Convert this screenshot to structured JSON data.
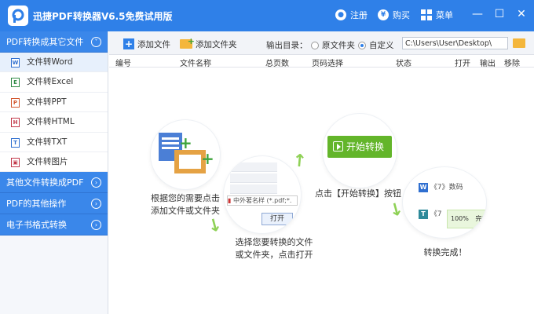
{
  "app": {
    "title": "迅捷PDF转换器V6.5免费试用版",
    "accent": "#2f80e8",
    "register": "注册",
    "buy": "购买",
    "menu": "菜单"
  },
  "sidebar": {
    "groups": [
      {
        "label": "PDF转换成其它文件",
        "expanded": true
      },
      {
        "label": "其他文件转换成PDF",
        "expanded": false
      },
      {
        "label": "PDF的其他操作",
        "expanded": false
      },
      {
        "label": "电子书格式转换",
        "expanded": false
      }
    ],
    "items": [
      {
        "label": "文件转Word",
        "icon": "W",
        "color": "#2f6fd0"
      },
      {
        "label": "文件转Excel",
        "icon": "E",
        "color": "#2e8a45"
      },
      {
        "label": "文件转PPT",
        "icon": "P",
        "color": "#d2562d"
      },
      {
        "label": "文件转HTML",
        "icon": "H",
        "color": "#c2384a"
      },
      {
        "label": "文件转TXT",
        "icon": "T",
        "color": "#2f6fd0"
      },
      {
        "label": "文件转图片",
        "icon": "▣",
        "color": "#c2384a"
      }
    ]
  },
  "toolbar": {
    "add_file": "添加文件",
    "add_folder": "添加文件夹",
    "output_label": "输出目录：",
    "opt_original": "原文件夹",
    "opt_custom": "自定义",
    "path_value": "C:\\Users\\User\\Desktop\\"
  },
  "table": {
    "headers": [
      "编号",
      "文件名称",
      "总页数",
      "页码选择",
      "状态",
      "打开",
      "输出",
      "移除"
    ]
  },
  "guide": {
    "step1": "根据您的需要点击\n添加文件或文件夹",
    "step2": "选择您要转换的文件\n或文件夹，点击打开",
    "step3": "点击【开始转换】按钮",
    "step4": "转换完成！",
    "start_btn": "开始转换",
    "open_btn": "打开",
    "dialog_path": "中外著名样",
    "dialog_filter": "(*.pdf;*.",
    "done_row1": "《7》数码",
    "done_row2": "《7",
    "done_progress": "100%",
    "done_status": "完成"
  }
}
